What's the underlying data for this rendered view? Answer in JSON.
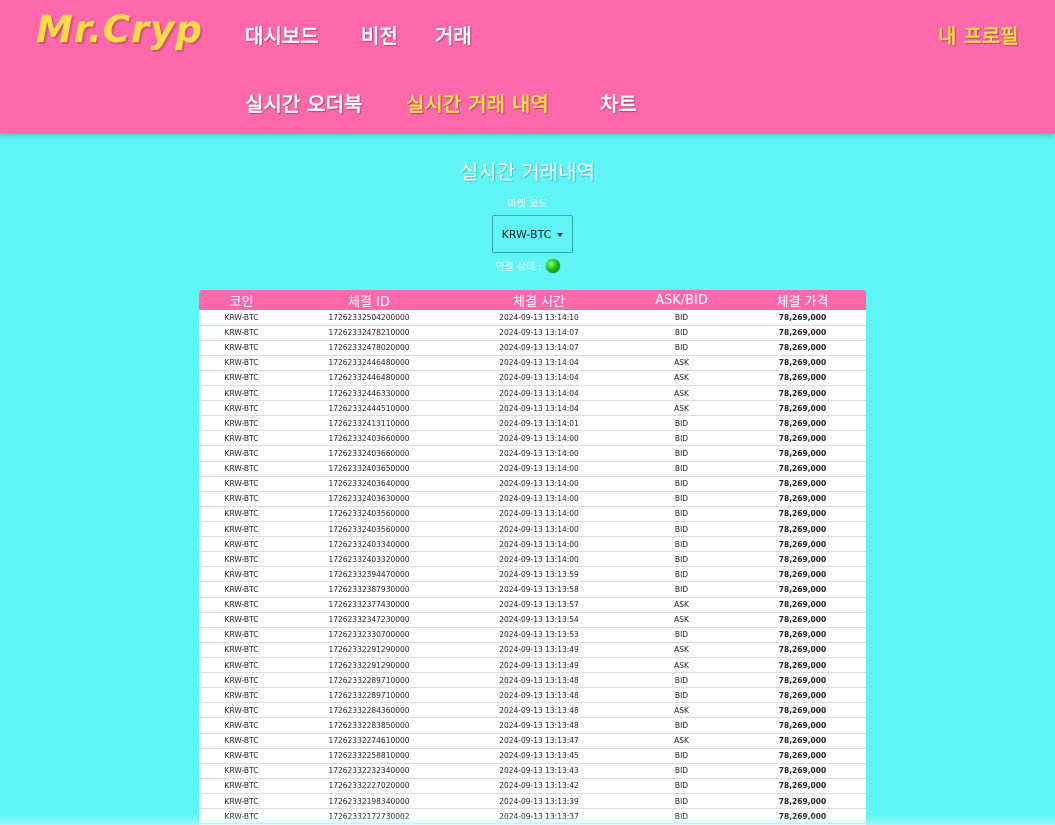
{
  "header": {
    "logo": "Mr.Cryp",
    "nav": {
      "dashboard": "대시보드",
      "vision": "비전",
      "trade": "거래",
      "profile": "내 프로필"
    },
    "subnav": {
      "orderbook": "실시간 오더북",
      "history": "실시간 거래 내역",
      "chart": "차트"
    }
  },
  "main": {
    "title": "실시간 거래내역",
    "market_label": "마켓 코드",
    "market_value": "KRW-BTC",
    "status_label": "연결 상태 :",
    "status_color": "#1bbf1b"
  },
  "colors": {
    "header_bg": "#ff69ac",
    "page_bg": "#5ff5f6",
    "accent": "#ffd84d"
  },
  "table": {
    "columns": [
      "코인",
      "체결 ID",
      "체결 시간",
      "ASK/BID",
      "체결 가격"
    ],
    "rows": [
      [
        "KRW-BTC",
        "17262332504200000",
        "2024-09-13 13:14:10",
        "BID",
        "78,269,000"
      ],
      [
        "KRW-BTC",
        "17262332478210000",
        "2024-09-13 13:14:07",
        "BID",
        "78,269,000"
      ],
      [
        "KRW-BTC",
        "17262332478020000",
        "2024-09-13 13:14:07",
        "BID",
        "78,269,000"
      ],
      [
        "KRW-BTC",
        "17262332446480000",
        "2024-09-13 13:14:04",
        "ASK",
        "78,269,000"
      ],
      [
        "KRW-BTC",
        "17262332446480000",
        "2024-09-13 13:14:04",
        "ASK",
        "78,269,000"
      ],
      [
        "KRW-BTC",
        "17262332446330000",
        "2024-09-13 13:14:04",
        "ASK",
        "78,269,000"
      ],
      [
        "KRW-BTC",
        "17262332444510000",
        "2024-09-13 13:14:04",
        "ASK",
        "78,269,000"
      ],
      [
        "KRW-BTC",
        "17262332413110000",
        "2024-09-13 13:14:01",
        "BID",
        "78,269,000"
      ],
      [
        "KRW-BTC",
        "17262332403660000",
        "2024-09-13 13:14:00",
        "BID",
        "78,269,000"
      ],
      [
        "KRW-BTC",
        "17262332403660000",
        "2024-09-13 13:14:00",
        "BID",
        "78,269,000"
      ],
      [
        "KRW-BTC",
        "17262332403650000",
        "2024-09-13 13:14:00",
        "BID",
        "78,269,000"
      ],
      [
        "KRW-BTC",
        "17262332403640000",
        "2024-09-13 13:14:00",
        "BID",
        "78,269,000"
      ],
      [
        "KRW-BTC",
        "17262332403630000",
        "2024-09-13 13:14:00",
        "BID",
        "78,269,000"
      ],
      [
        "KRW-BTC",
        "17262332403560000",
        "2024-09-13 13:14:00",
        "BID",
        "78,269,000"
      ],
      [
        "KRW-BTC",
        "17262332403560000",
        "2024-09-13 13:14:00",
        "BID",
        "78,269,000"
      ],
      [
        "KRW-BTC",
        "17262332403340000",
        "2024-09-13 13:14:00",
        "BID",
        "78,269,000"
      ],
      [
        "KRW-BTC",
        "17262332403320000",
        "2024-09-13 13:14:00",
        "BID",
        "78,269,000"
      ],
      [
        "KRW-BTC",
        "17262332394470000",
        "2024-09-13 13:13:59",
        "BID",
        "78,269,000"
      ],
      [
        "KRW-BTC",
        "17262332387930000",
        "2024-09-13 13:13:58",
        "BID",
        "78,269,000"
      ],
      [
        "KRW-BTC",
        "17262332377430000",
        "2024-09-13 13:13:57",
        "ASK",
        "78,269,000"
      ],
      [
        "KRW-BTC",
        "17262332347230000",
        "2024-09-13 13:13:54",
        "ASK",
        "78,269,000"
      ],
      [
        "KRW-BTC",
        "17262332330700000",
        "2024-09-13 13:13:53",
        "BID",
        "78,269,000"
      ],
      [
        "KRW-BTC",
        "17262332291290000",
        "2024-09-13 13:13:49",
        "ASK",
        "78,269,000"
      ],
      [
        "KRW-BTC",
        "17262332291290000",
        "2024-09-13 13:13:49",
        "ASK",
        "78,269,000"
      ],
      [
        "KRW-BTC",
        "17262332289710000",
        "2024-09-13 13:13:48",
        "BID",
        "78,269,000"
      ],
      [
        "KRW-BTC",
        "17262332289710000",
        "2024-09-13 13:13:48",
        "BID",
        "78,269,000"
      ],
      [
        "KRW-BTC",
        "17262332284360000",
        "2024-09-13 13:13:48",
        "ASK",
        "78,269,000"
      ],
      [
        "KRW-BTC",
        "17262332283850000",
        "2024-09-13 13:13:48",
        "BID",
        "78,269,000"
      ],
      [
        "KRW-BTC",
        "17262332274610000",
        "2024-09-13 13:13:47",
        "ASK",
        "78,269,000"
      ],
      [
        "KRW-BTC",
        "17262332258810000",
        "2024-09-13 13:13:45",
        "BID",
        "78,269,000"
      ],
      [
        "KRW-BTC",
        "17262332232340000",
        "2024-09-13 13:13:43",
        "BID",
        "78,269,000"
      ],
      [
        "KRW-BTC",
        "17262332227020000",
        "2024-09-13 13:13:42",
        "BID",
        "78,269,000"
      ],
      [
        "KRW-BTC",
        "17262332198340000",
        "2024-09-13 13:13:39",
        "BID",
        "78,269,000"
      ],
      [
        "KRW-BTC",
        "17262332172730002",
        "2024-09-13 13:13:37",
        "BID",
        "78,269,000"
      ]
    ]
  }
}
